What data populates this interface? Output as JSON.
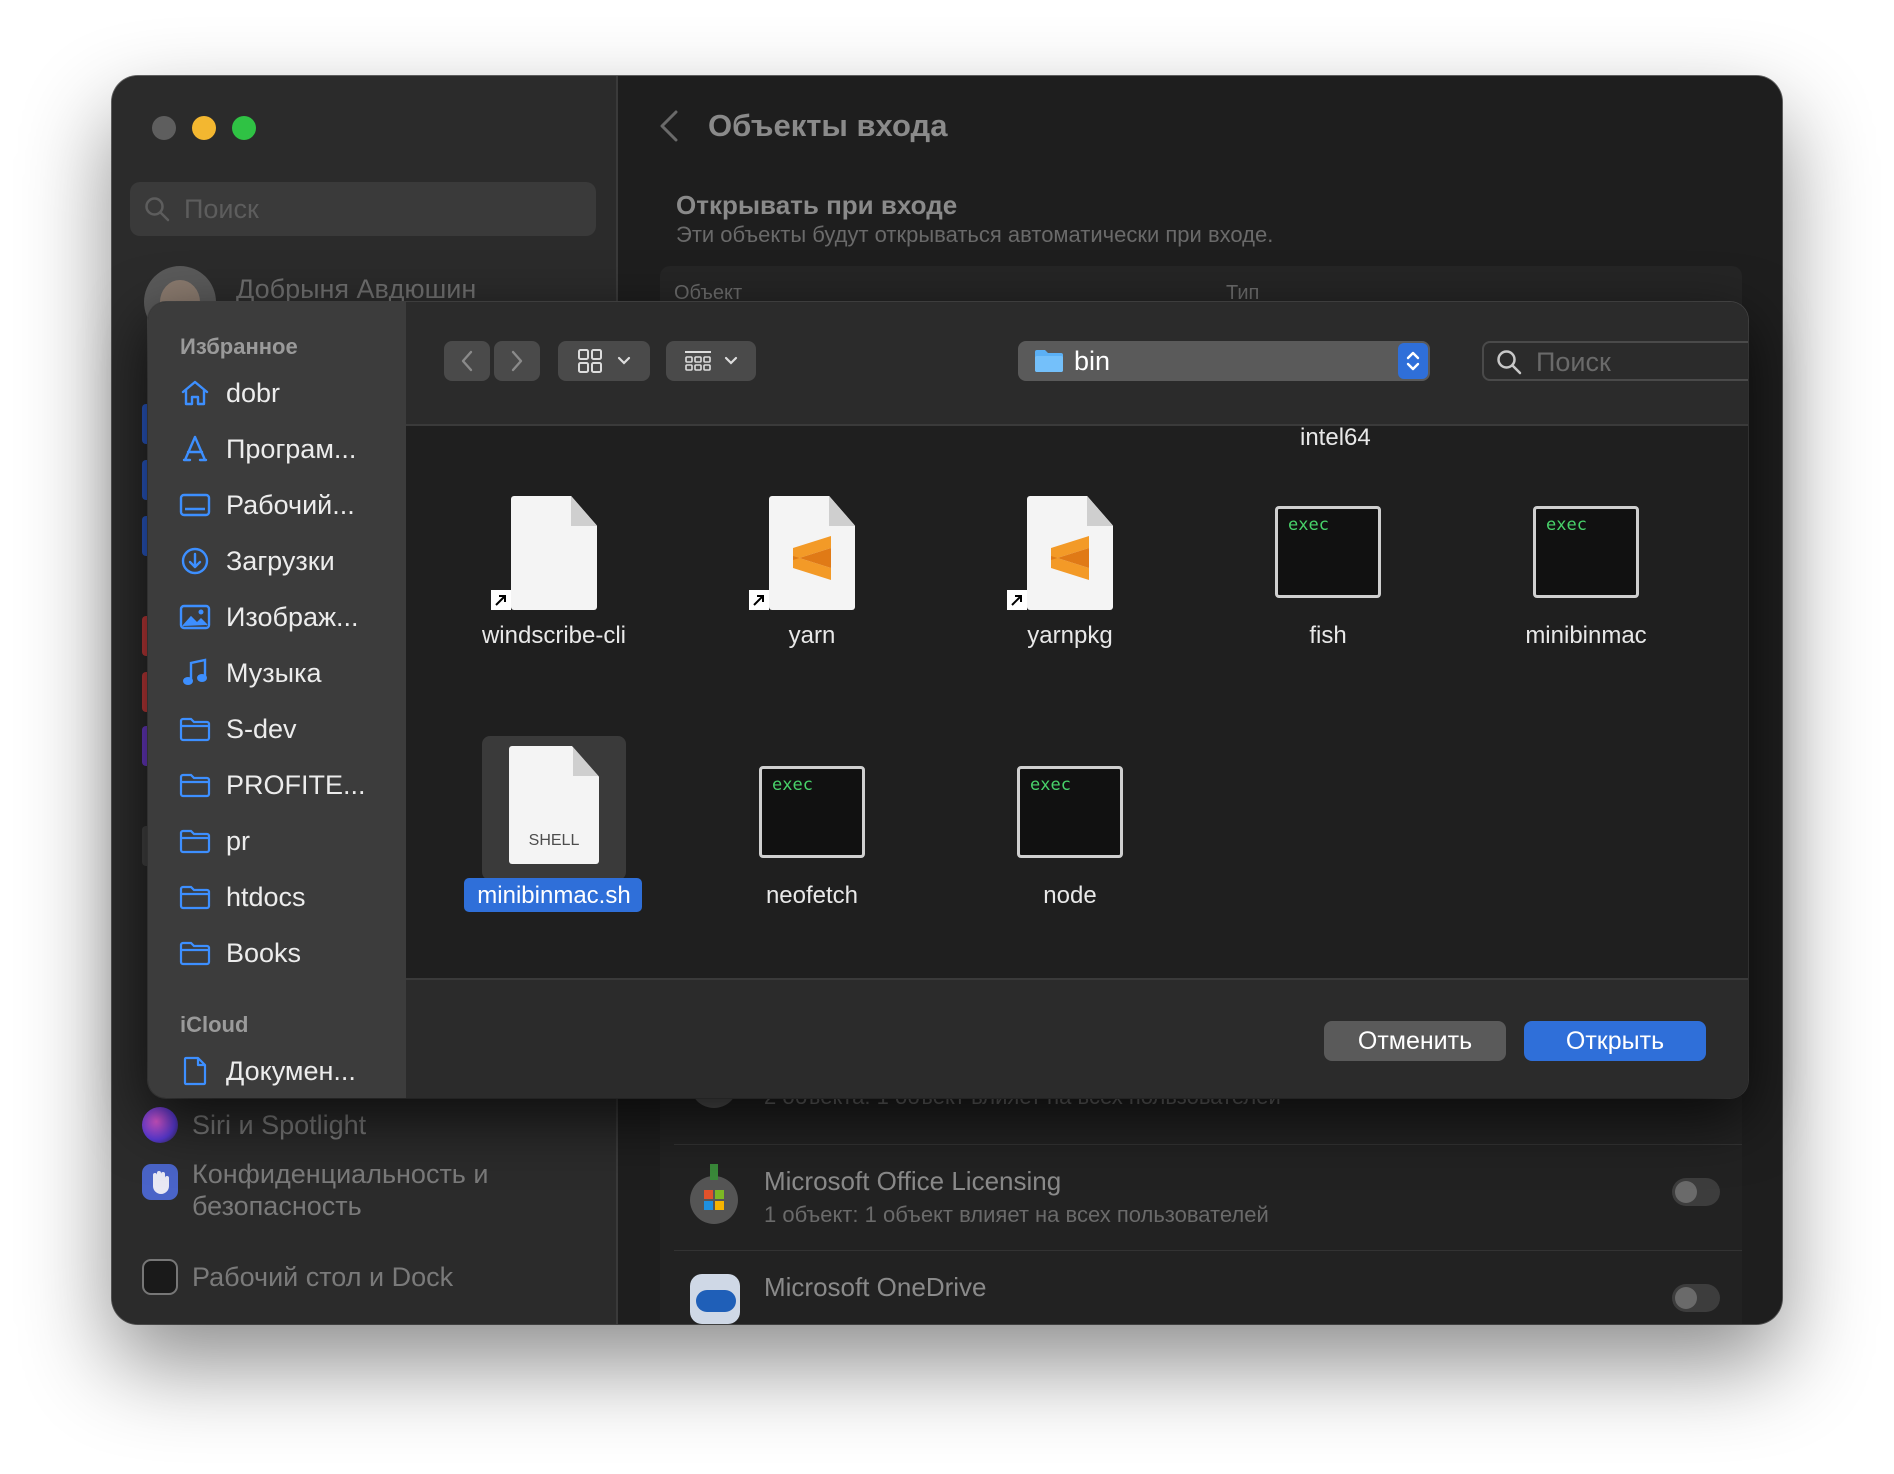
{
  "window": {
    "traffic_lights": [
      "#5e5e5e",
      "#f3b730",
      "#2fc244"
    ],
    "sidebar": {
      "search_placeholder": "Поиск",
      "user_name": "Добрыня Авдюшин",
      "bottom_items": [
        {
          "label": "Siri и Spotlight",
          "icon": "siri-icon",
          "color": "#a14ee6"
        },
        {
          "label": "Конфиденциальность и безопасность",
          "icon": "hand-icon",
          "color": "#4a64c8"
        },
        {
          "label": "Рабочий стол и Dock",
          "icon": "dock-icon",
          "color": "#2a2a2a"
        }
      ]
    },
    "main": {
      "title": "Объекты входа",
      "section_title": "Открывать при входе",
      "section_subtitle": "Эти объекты будут открываться автоматически при входе.",
      "col_object": "Объект",
      "col_type": "Тип",
      "background_items": [
        {
          "name": "",
          "detail": "2 объекта: 1 объект влияет на всех пользователей"
        },
        {
          "name": "Microsoft Office Licensing",
          "detail": "1 объект: 1 объект влияет на всех пользователей"
        },
        {
          "name": "Microsoft OneDrive",
          "detail": ""
        }
      ]
    }
  },
  "dialog": {
    "favorites_header": "Избранное",
    "favorites": [
      {
        "label": "dobr",
        "icon": "home-icon"
      },
      {
        "label": "Програм...",
        "icon": "applications-icon"
      },
      {
        "label": "Рабочий...",
        "icon": "desktop-icon"
      },
      {
        "label": "Загрузки",
        "icon": "downloads-icon"
      },
      {
        "label": "Изображ...",
        "icon": "pictures-icon"
      },
      {
        "label": "Музыка",
        "icon": "music-icon"
      },
      {
        "label": "S-dev",
        "icon": "folder-icon"
      },
      {
        "label": "PROFITE...",
        "icon": "folder-icon"
      },
      {
        "label": "pr",
        "icon": "folder-icon"
      },
      {
        "label": "htdocs",
        "icon": "folder-icon"
      },
      {
        "label": "Books",
        "icon": "folder-icon"
      }
    ],
    "icloud_header": "iCloud",
    "icloud": [
      {
        "label": "Докумен...",
        "icon": "document-icon"
      }
    ],
    "toolbar": {
      "current_folder": "bin",
      "search_placeholder": "Поиск"
    },
    "partial_item": "intel64",
    "files": [
      {
        "name": "windscribe-cli",
        "kind": "document-alias"
      },
      {
        "name": "yarn",
        "kind": "sublime-alias"
      },
      {
        "name": "yarnpkg",
        "kind": "sublime-alias"
      },
      {
        "name": "fish",
        "kind": "exec",
        "badge": "exec"
      },
      {
        "name": "minibinmac",
        "kind": "exec",
        "badge": "exec"
      },
      {
        "name": "minibinmac.sh",
        "kind": "shell",
        "badge": "SHELL",
        "selected": true
      },
      {
        "name": "neofetch",
        "kind": "exec",
        "badge": "exec"
      },
      {
        "name": "node",
        "kind": "exec",
        "badge": "exec"
      }
    ],
    "buttons": {
      "cancel": "Отменить",
      "open": "Открыть"
    },
    "accent": "#2f6fd9"
  }
}
